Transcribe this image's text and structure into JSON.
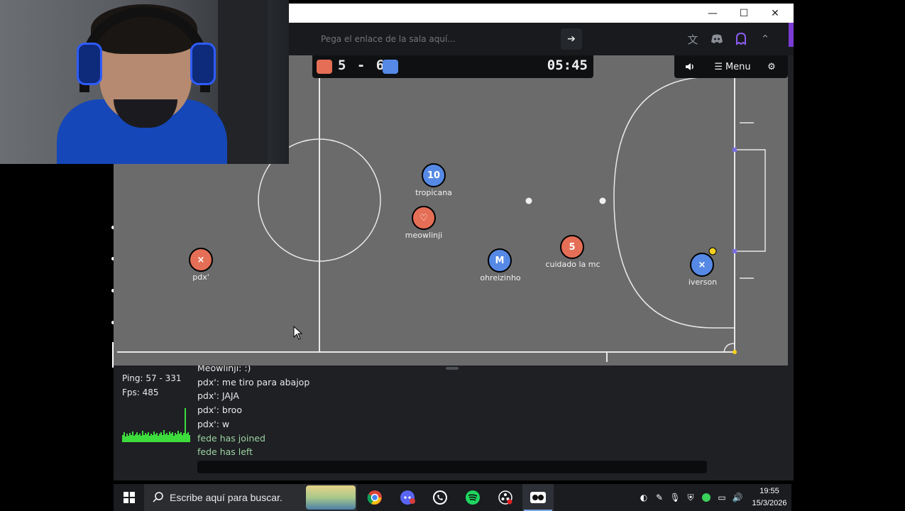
{
  "window": {
    "controls": {
      "minimize": "—",
      "maximize": "☐",
      "close": "✕"
    }
  },
  "urlbar": {
    "placeholder": "Pega el enlace de la sala aquí...",
    "go_icon": "arrow-right-icon",
    "icons": [
      "translate-icon",
      "discord-icon",
      "ghost-icon",
      "chevron-up-icon"
    ]
  },
  "scoreboard": {
    "red_score": "5",
    "separator": "-",
    "blue_score": "6",
    "score_text": "5 - 6",
    "timer": "05:45",
    "red_color": "#e56e56",
    "blue_color": "#5689e5"
  },
  "menu": {
    "sound_icon": "speaker-icon",
    "menu_label": "Menu",
    "settings_icon": "gear-icon"
  },
  "players": [
    {
      "name": "tropicana",
      "avatar": "10",
      "team": "blue"
    },
    {
      "name": "meowlinji",
      "avatar": "♡",
      "team": "red"
    },
    {
      "name": "pdx'",
      "avatar": "×",
      "team": "red"
    },
    {
      "name": "ohreizinho",
      "avatar": "M",
      "team": "blue"
    },
    {
      "name": "cuidado la mc",
      "avatar": "5",
      "team": "red"
    },
    {
      "name": "iverson",
      "avatar": "×",
      "team": "blue"
    }
  ],
  "stats": {
    "ping": "Ping: 57 - 331",
    "fps": "Fps: 485"
  },
  "chat": {
    "messages": [
      {
        "text": "Meowlinji: :)",
        "type": "user"
      },
      {
        "text": "pdx': me tiro para abajop",
        "type": "user"
      },
      {
        "text": "pdx': JAJA",
        "type": "user"
      },
      {
        "text": "pdx': broo",
        "type": "user"
      },
      {
        "text": "pdx': w",
        "type": "user"
      },
      {
        "text": "fede has joined",
        "type": "system"
      },
      {
        "text": "fede has left",
        "type": "system"
      }
    ]
  },
  "taskbar": {
    "search_placeholder": "Escribe aquí para buscar.",
    "apps": [
      "chrome-icon",
      "discord-icon",
      "whatsapp-icon",
      "spotify-icon",
      "obs-icon",
      "haxball-icon"
    ],
    "time": "19:55",
    "date": "15/3/2026"
  }
}
